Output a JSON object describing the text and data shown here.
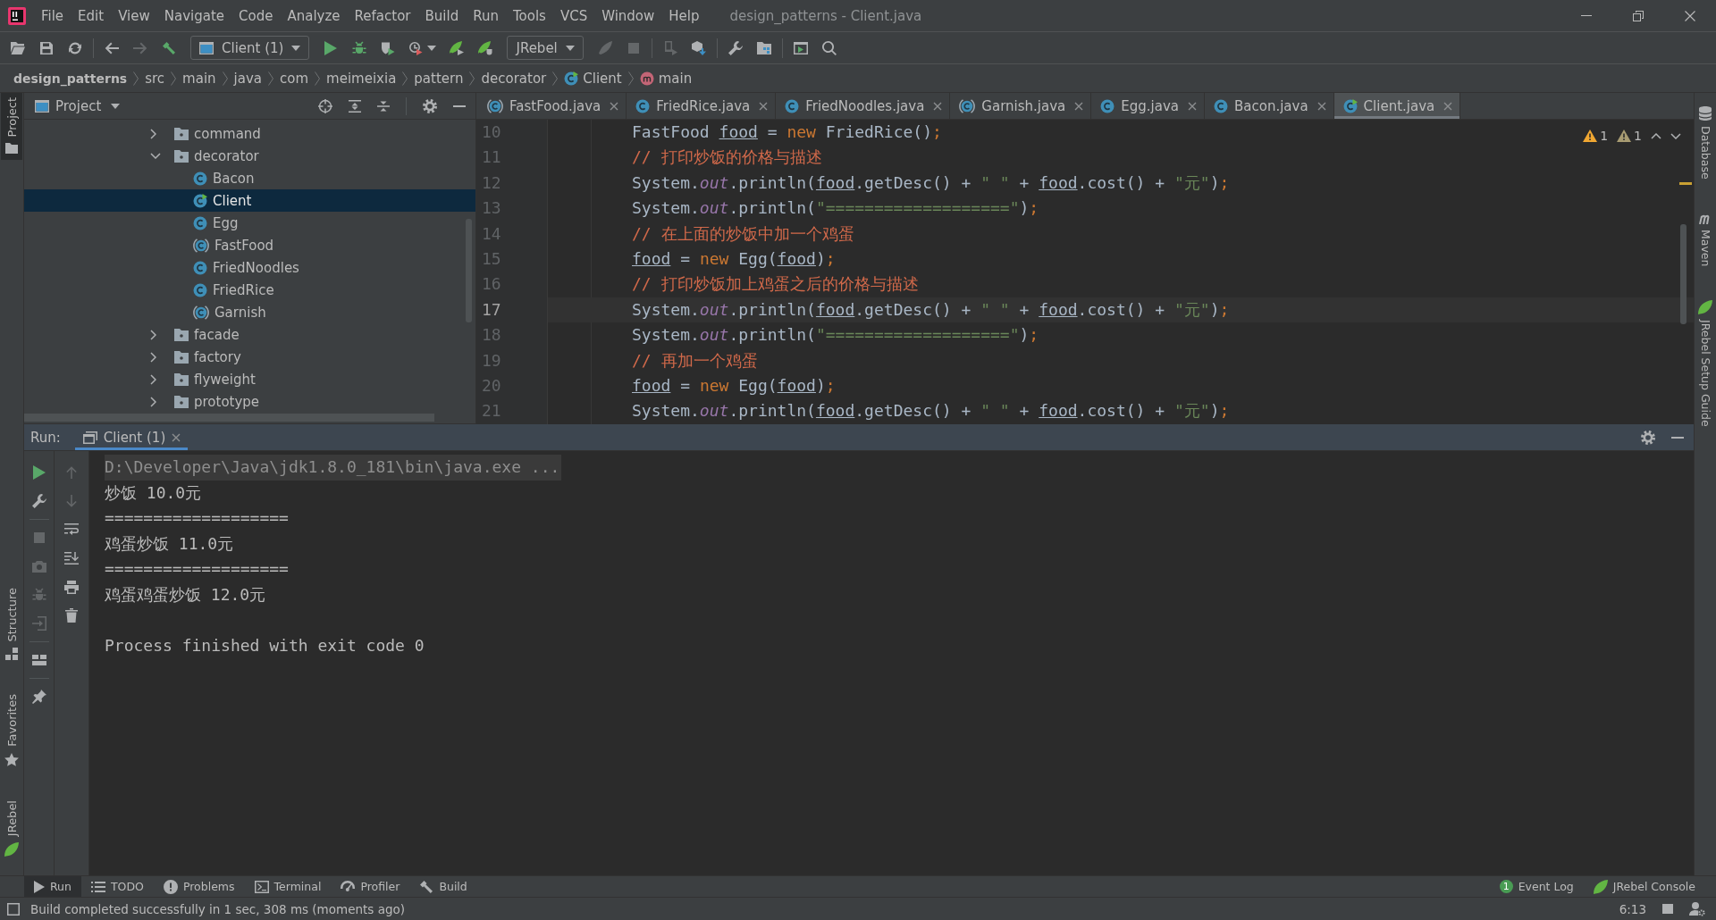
{
  "window": {
    "title": "design_patterns - Client.java"
  },
  "menu": [
    "File",
    "Edit",
    "View",
    "Navigate",
    "Code",
    "Analyze",
    "Refactor",
    "Build",
    "Run",
    "Tools",
    "VCS",
    "Window",
    "Help"
  ],
  "toolbar": {
    "groups": [
      {
        "items": [
          {
            "kind": "open",
            "disabled": false
          },
          {
            "kind": "save",
            "disabled": false
          },
          {
            "kind": "sync",
            "disabled": false
          }
        ]
      },
      {
        "items": [
          {
            "kind": "back",
            "disabled": false
          },
          {
            "kind": "forward",
            "disabled": true
          },
          {
            "kind": "build",
            "disabled": false
          },
          {
            "kind": "run_config",
            "label": "Client (1)",
            "disabled": false
          },
          {
            "kind": "run",
            "disabled": false
          },
          {
            "kind": "debug",
            "disabled": false
          },
          {
            "kind": "coverage",
            "disabled": false
          },
          {
            "kind": "profile",
            "disabled": false
          },
          {
            "kind": "jrebel_run",
            "disabled": false
          },
          {
            "kind": "jrebel_debug",
            "disabled": false
          },
          {
            "kind": "menu",
            "label": "JRebel",
            "disabled": false
          },
          {
            "kind": "attach",
            "disabled": true
          },
          {
            "kind": "stop",
            "disabled": true
          }
        ]
      },
      {
        "items": [
          {
            "kind": "device",
            "disabled": true
          },
          {
            "kind": "dependencies",
            "disabled": false
          }
        ]
      },
      {
        "items": [
          {
            "kind": "settings",
            "disabled": false
          },
          {
            "kind": "project_structure",
            "disabled": false
          }
        ]
      },
      {
        "items": [
          {
            "kind": "run_window",
            "disabled": false
          },
          {
            "kind": "search",
            "disabled": false
          }
        ]
      }
    ]
  },
  "breadcrumbs": [
    {
      "label": "design_patterns",
      "kind": "project"
    },
    {
      "label": "src",
      "kind": "folder"
    },
    {
      "label": "main",
      "kind": "folder"
    },
    {
      "label": "java",
      "kind": "folder"
    },
    {
      "label": "com",
      "kind": "folder"
    },
    {
      "label": "meimeixia",
      "kind": "folder"
    },
    {
      "label": "pattern",
      "kind": "folder"
    },
    {
      "label": "decorator",
      "kind": "folder"
    },
    {
      "label": "Client",
      "kind": "main_class"
    },
    {
      "label": "main",
      "kind": "method"
    }
  ],
  "left_stripe": {
    "top": [
      {
        "label": "Project",
        "kind": "project",
        "selected": true
      }
    ],
    "bottom": [
      {
        "label": "Structure",
        "kind": "structure",
        "selected": false
      },
      {
        "label": "Favorites",
        "kind": "favorites",
        "selected": false
      },
      {
        "label": "JRebel",
        "kind": "jrebel",
        "selected": false
      }
    ]
  },
  "project_panel": {
    "title": "Project",
    "tree": [
      {
        "label": "command",
        "kind": "package",
        "expanded": false,
        "selected": false
      },
      {
        "label": "decorator",
        "kind": "package",
        "expanded": true,
        "selected": false,
        "children": [
          {
            "label": "Bacon",
            "kind": "class",
            "selected": false
          },
          {
            "label": "Client",
            "kind": "main_class",
            "selected": true
          },
          {
            "label": "Egg",
            "kind": "class",
            "selected": false
          },
          {
            "label": "FastFood",
            "kind": "abstract_class",
            "selected": false
          },
          {
            "label": "FriedNoodles",
            "kind": "class",
            "selected": false
          },
          {
            "label": "FriedRice",
            "kind": "class",
            "selected": false
          },
          {
            "label": "Garnish",
            "kind": "abstract_class",
            "selected": false
          }
        ]
      },
      {
        "label": "facade",
        "kind": "package",
        "expanded": false,
        "selected": false
      },
      {
        "label": "factory",
        "kind": "package",
        "expanded": false,
        "selected": false
      },
      {
        "label": "flyweight",
        "kind": "package",
        "expanded": false,
        "selected": false
      },
      {
        "label": "prototype",
        "kind": "package",
        "expanded": false,
        "selected": false
      }
    ]
  },
  "editor": {
    "tabs": [
      {
        "label": "FastFood.java",
        "kind": "abstract_class",
        "selected": false
      },
      {
        "label": "FriedRice.java",
        "kind": "class",
        "selected": false
      },
      {
        "label": "FriedNoodles.java",
        "kind": "class",
        "selected": false
      },
      {
        "label": "Garnish.java",
        "kind": "abstract_class",
        "selected": false
      },
      {
        "label": "Egg.java",
        "kind": "class",
        "selected": false
      },
      {
        "label": "Bacon.java",
        "kind": "class",
        "selected": false
      },
      {
        "label": "Client.java",
        "kind": "main_class",
        "selected": true
      }
    ],
    "inspections": [
      {
        "kind": "warning",
        "count": "1"
      },
      {
        "kind": "weak_warning",
        "count": "1"
      }
    ],
    "lines": [
      {
        "number": "10",
        "current": false,
        "tokens": [
          {
            "kind": "plain",
            "text": "FastFood "
          },
          {
            "kind": "local_var",
            "text": "food"
          },
          {
            "kind": "plain",
            "text": " = "
          },
          {
            "kind": "keyword",
            "text": "new"
          },
          {
            "kind": "plain",
            "text": " FriedRice()"
          },
          {
            "kind": "punct",
            "text": ";"
          }
        ]
      },
      {
        "number": "11",
        "current": false,
        "tokens": [
          {
            "kind": "comment",
            "text": "// 打印炒饭的价格与描述"
          }
        ]
      },
      {
        "number": "12",
        "current": false,
        "tokens": [
          {
            "kind": "plain",
            "text": "System."
          },
          {
            "kind": "static_field",
            "text": "out"
          },
          {
            "kind": "plain",
            "text": ".println("
          },
          {
            "kind": "local_var",
            "text": "food"
          },
          {
            "kind": "plain",
            "text": ".getDesc() + "
          },
          {
            "kind": "string",
            "text": "\" \""
          },
          {
            "kind": "plain",
            "text": " + "
          },
          {
            "kind": "local_var",
            "text": "food"
          },
          {
            "kind": "plain",
            "text": ".cost() + "
          },
          {
            "kind": "string",
            "text": "\"元\""
          },
          {
            "kind": "plain",
            "text": ")"
          },
          {
            "kind": "punct",
            "text": ";"
          }
        ]
      },
      {
        "number": "13",
        "current": false,
        "tokens": [
          {
            "kind": "plain",
            "text": "System."
          },
          {
            "kind": "static_field",
            "text": "out"
          },
          {
            "kind": "plain",
            "text": ".println("
          },
          {
            "kind": "string",
            "text": "\"===================\""
          },
          {
            "kind": "plain",
            "text": ")"
          },
          {
            "kind": "punct",
            "text": ";"
          }
        ]
      },
      {
        "number": "14",
        "current": false,
        "tokens": [
          {
            "kind": "comment",
            "text": "// 在上面的炒饭中加一个鸡蛋"
          }
        ]
      },
      {
        "number": "15",
        "current": false,
        "tokens": [
          {
            "kind": "local_var",
            "text": "food"
          },
          {
            "kind": "plain",
            "text": " = "
          },
          {
            "kind": "keyword",
            "text": "new"
          },
          {
            "kind": "plain",
            "text": " Egg("
          },
          {
            "kind": "local_var",
            "text": "food"
          },
          {
            "kind": "plain",
            "text": ")"
          },
          {
            "kind": "punct",
            "text": ";"
          }
        ]
      },
      {
        "number": "16",
        "current": false,
        "tokens": [
          {
            "kind": "comment",
            "text": "// 打印炒饭加上鸡蛋之后的价格与描述"
          }
        ]
      },
      {
        "number": "17",
        "current": true,
        "tokens": [
          {
            "kind": "plain",
            "text": "System."
          },
          {
            "kind": "static_field",
            "text": "out"
          },
          {
            "kind": "plain",
            "text": ".println("
          },
          {
            "kind": "local_var",
            "text": "food"
          },
          {
            "kind": "plain",
            "text": ".getDesc() + "
          },
          {
            "kind": "string",
            "text": "\" \""
          },
          {
            "kind": "plain",
            "text": " + "
          },
          {
            "kind": "local_var",
            "text": "food"
          },
          {
            "kind": "plain",
            "text": ".cost() + "
          },
          {
            "kind": "string",
            "text": "\"元\""
          },
          {
            "kind": "plain",
            "text": ")"
          },
          {
            "kind": "punct",
            "text": ";"
          }
        ]
      },
      {
        "number": "18",
        "current": false,
        "tokens": [
          {
            "kind": "plain",
            "text": "System."
          },
          {
            "kind": "static_field",
            "text": "out"
          },
          {
            "kind": "plain",
            "text": ".println("
          },
          {
            "kind": "string",
            "text": "\"===================\""
          },
          {
            "kind": "plain",
            "text": ")"
          },
          {
            "kind": "punct",
            "text": ";"
          }
        ]
      },
      {
        "number": "19",
        "current": false,
        "tokens": [
          {
            "kind": "comment",
            "text": "// 再加一个鸡蛋"
          }
        ]
      },
      {
        "number": "20",
        "current": false,
        "tokens": [
          {
            "kind": "local_var",
            "text": "food"
          },
          {
            "kind": "plain",
            "text": " = "
          },
          {
            "kind": "keyword",
            "text": "new"
          },
          {
            "kind": "plain",
            "text": " Egg("
          },
          {
            "kind": "local_var",
            "text": "food"
          },
          {
            "kind": "plain",
            "text": ")"
          },
          {
            "kind": "punct",
            "text": ";"
          }
        ]
      },
      {
        "number": "21",
        "current": false,
        "tokens": [
          {
            "kind": "plain",
            "text": "System."
          },
          {
            "kind": "static_field",
            "text": "out"
          },
          {
            "kind": "plain",
            "text": ".println("
          },
          {
            "kind": "local_var",
            "text": "food"
          },
          {
            "kind": "plain",
            "text": ".getDesc() + "
          },
          {
            "kind": "string",
            "text": "\" \""
          },
          {
            "kind": "plain",
            "text": " + "
          },
          {
            "kind": "local_var",
            "text": "food"
          },
          {
            "kind": "plain",
            "text": ".cost() + "
          },
          {
            "kind": "string",
            "text": "\"元\""
          },
          {
            "kind": "plain",
            "text": ")"
          },
          {
            "kind": "punct",
            "text": ";"
          }
        ]
      }
    ]
  },
  "right_stripe": [
    {
      "label": "Database",
      "kind": "database",
      "selected": false
    },
    {
      "label": "Maven",
      "kind": "maven",
      "selected": false
    },
    {
      "label": "JRebel Setup Guide",
      "kind": "jrebel",
      "selected": false
    }
  ],
  "run_panel": {
    "label": "Run:",
    "tabs": [
      {
        "label": "Client (1)",
        "selected": true
      }
    ],
    "side_toolbars": [
      {
        "groups": [
          {
            "items": [
              {
                "kind": "rerun",
                "disabled": false
              },
              {
                "kind": "settings",
                "disabled": false
              }
            ]
          },
          {
            "items": [
              {
                "kind": "stop",
                "disabled": true
              },
              {
                "kind": "thread_dump",
                "disabled": true
              },
              {
                "kind": "attach_debugger",
                "disabled": true
              },
              {
                "kind": "exit",
                "disabled": true
              }
            ]
          },
          {
            "items": [
              {
                "kind": "layout",
                "disabled": false
              }
            ]
          },
          {
            "items": [
              {
                "kind": "pin",
                "disabled": false
              }
            ]
          }
        ]
      },
      {
        "groups": [
          {
            "items": [
              {
                "kind": "previous",
                "disabled": true
              },
              {
                "kind": "next",
                "disabled": true
              },
              {
                "kind": "soft_wrap",
                "disabled": false
              },
              {
                "kind": "scroll_to_end",
                "disabled": false
              },
              {
                "kind": "print",
                "disabled": false
              },
              {
                "kind": "clear",
                "disabled": false
              }
            ]
          }
        ]
      }
    ],
    "output": [
      {
        "kind": "command",
        "text": "D:\\Developer\\Java\\jdk1.8.0_181\\bin\\java.exe ..."
      },
      {
        "kind": "stdout",
        "text": "炒饭 10.0元"
      },
      {
        "kind": "stdout",
        "text": "==================="
      },
      {
        "kind": "stdout",
        "text": "鸡蛋炒饭 11.0元"
      },
      {
        "kind": "stdout",
        "text": "==================="
      },
      {
        "kind": "stdout",
        "text": "鸡蛋鸡蛋炒饭 12.0元"
      },
      {
        "kind": "exit",
        "text": "Process finished with exit code 0"
      }
    ]
  },
  "bottom_bar": {
    "left": [
      {
        "label": "Run",
        "kind": "run",
        "selected": true
      },
      {
        "label": "TODO",
        "kind": "todo",
        "selected": false
      },
      {
        "label": "Problems",
        "kind": "problems",
        "selected": false
      },
      {
        "label": "Terminal",
        "kind": "terminal",
        "selected": false
      },
      {
        "label": "Profiler",
        "kind": "profiler",
        "selected": false
      },
      {
        "label": "Build",
        "kind": "build",
        "selected": false
      }
    ],
    "right": [
      {
        "label": "Event Log",
        "kind": "event_log",
        "badge": "1",
        "selected": false
      },
      {
        "label": "JRebel Console",
        "kind": "jrebel",
        "selected": false
      }
    ]
  },
  "status_bar": {
    "message": "Build completed successfully in 1 sec, 308 ms (moments ago)",
    "caret_position": "6:13"
  }
}
